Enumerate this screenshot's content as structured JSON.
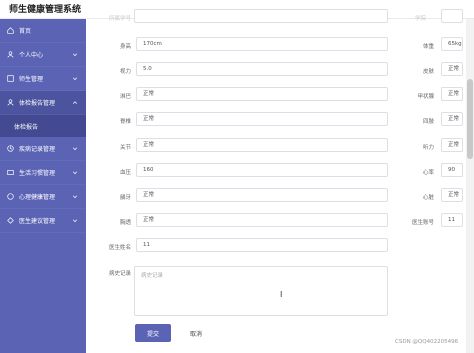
{
  "app": {
    "title": "师生健康管理系统"
  },
  "sidebar": {
    "items": [
      {
        "label": "首页",
        "icon": "home-icon"
      },
      {
        "label": "个人中心",
        "icon": "user-icon"
      },
      {
        "label": "师生管理",
        "icon": "people-icon"
      },
      {
        "label": "体检报告管理",
        "icon": "report-icon"
      },
      {
        "label": "体检报告",
        "icon": ""
      },
      {
        "label": "疾病记录管理",
        "icon": "clock-icon"
      },
      {
        "label": "生活习惯管理",
        "icon": "habit-icon"
      },
      {
        "label": "心理健康管理",
        "icon": "heart-icon"
      },
      {
        "label": "医生建议管理",
        "icon": "advice-icon"
      }
    ]
  },
  "form": {
    "cut_left_label": "所属学号",
    "cut_left_value": "",
    "cut_right_label": "学院",
    "fields_left": [
      {
        "label": "身高",
        "value": "170cm"
      },
      {
        "label": "视力",
        "value": "5.0"
      },
      {
        "label": "淋巴",
        "value": "正常"
      },
      {
        "label": "脊椎",
        "value": "正常"
      },
      {
        "label": "关节",
        "value": "正常"
      },
      {
        "label": "血压",
        "value": "160"
      },
      {
        "label": "龋牙",
        "value": "正常"
      },
      {
        "label": "胸透",
        "value": "正常"
      },
      {
        "label": "医生姓名",
        "value": "11"
      }
    ],
    "fields_right": [
      {
        "label": "体重",
        "value": "65kg"
      },
      {
        "label": "皮肤",
        "value": "正常"
      },
      {
        "label": "甲状腺",
        "value": "正常"
      },
      {
        "label": "四肢",
        "value": "正常"
      },
      {
        "label": "听力",
        "value": "正常"
      },
      {
        "label": "心率",
        "value": "90"
      },
      {
        "label": "心脏",
        "value": "正常"
      },
      {
        "label": "医生账号",
        "value": "11"
      }
    ],
    "history": {
      "label": "病史记录",
      "placeholder": "病史记录"
    },
    "submit_label": "提交",
    "cancel_label": "取消"
  },
  "watermark": "CSDN @QQ402205496"
}
